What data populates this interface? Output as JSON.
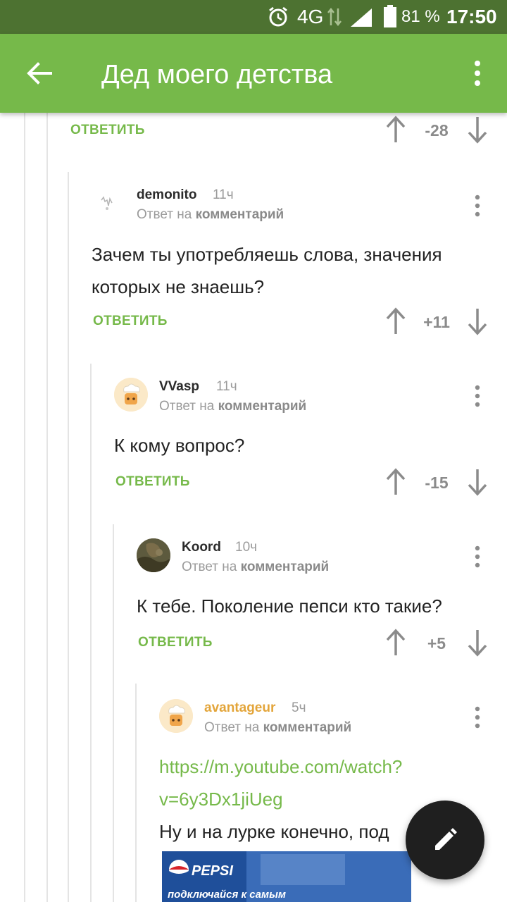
{
  "statusbar": {
    "network": "4G",
    "battery_percent": "81 %",
    "clock": "17:50",
    "icons": [
      "alarm-icon",
      "network-arrows-icon",
      "signal-icon",
      "battery-icon"
    ]
  },
  "appbar": {
    "title": "Дед моего детства",
    "back_icon": "arrow-back-icon",
    "menu_icon": "more-vert-icon"
  },
  "colors": {
    "statusbar": "#4d7231",
    "appbar": "#76b94a",
    "accent_green": "#76b94a",
    "orange_author": "#e3a53a",
    "fab": "#1f1f1f"
  },
  "labels": {
    "reply": "ОТВЕТИТЬ",
    "reply_to_prefix": "Ответ на",
    "reply_to_target": "комментарий"
  },
  "top_fragment": {
    "score": "-28"
  },
  "comments": [
    {
      "author": "demonito",
      "time": "11ч",
      "text": [
        "Зачем ты употребляешь слова, значения",
        "которых не знаешь?"
      ],
      "score": "+11"
    },
    {
      "author": "VVasp",
      "time": "11ч",
      "text": [
        "К кому вопрос?"
      ],
      "score": "-15"
    },
    {
      "author": "Koord",
      "time": "10ч",
      "text": [
        "К тебе. Поколение пепси кто такие?"
      ],
      "score": "+5"
    },
    {
      "author": "avantageur",
      "time": "5ч",
      "link": [
        "https://m.youtube.com/watch?",
        "v=6y3Dx1jiUeg"
      ],
      "text": [
        "Ну и на лурке конечно, под"
      ]
    }
  ],
  "embedded_image": {
    "brand": "PEPSI",
    "slogan": "подключайся к самым"
  },
  "fab": {
    "icon": "edit-pencil-icon"
  }
}
